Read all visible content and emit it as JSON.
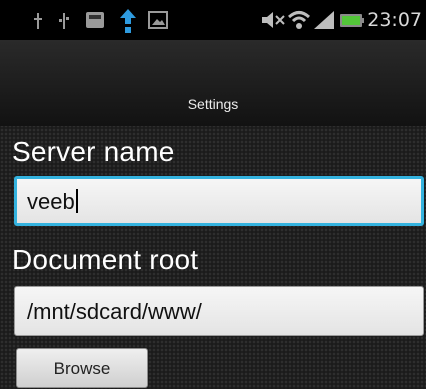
{
  "status_bar": {
    "time": "23:07",
    "icons": [
      "usb-debug-icon",
      "usb-icon",
      "sd-card-icon",
      "sync-icon",
      "image-icon",
      "mute-icon",
      "wifi-icon",
      "signal-icon",
      "battery-icon"
    ]
  },
  "title_bar": {
    "title": "Settings"
  },
  "form": {
    "server_name": {
      "label": "Server name",
      "value": "veeb"
    },
    "document_root": {
      "label": "Document root",
      "value": "/mnt/sdcard/www/"
    },
    "browse_label": "Browse"
  },
  "colors": {
    "focus_accent": "#34b3df"
  }
}
